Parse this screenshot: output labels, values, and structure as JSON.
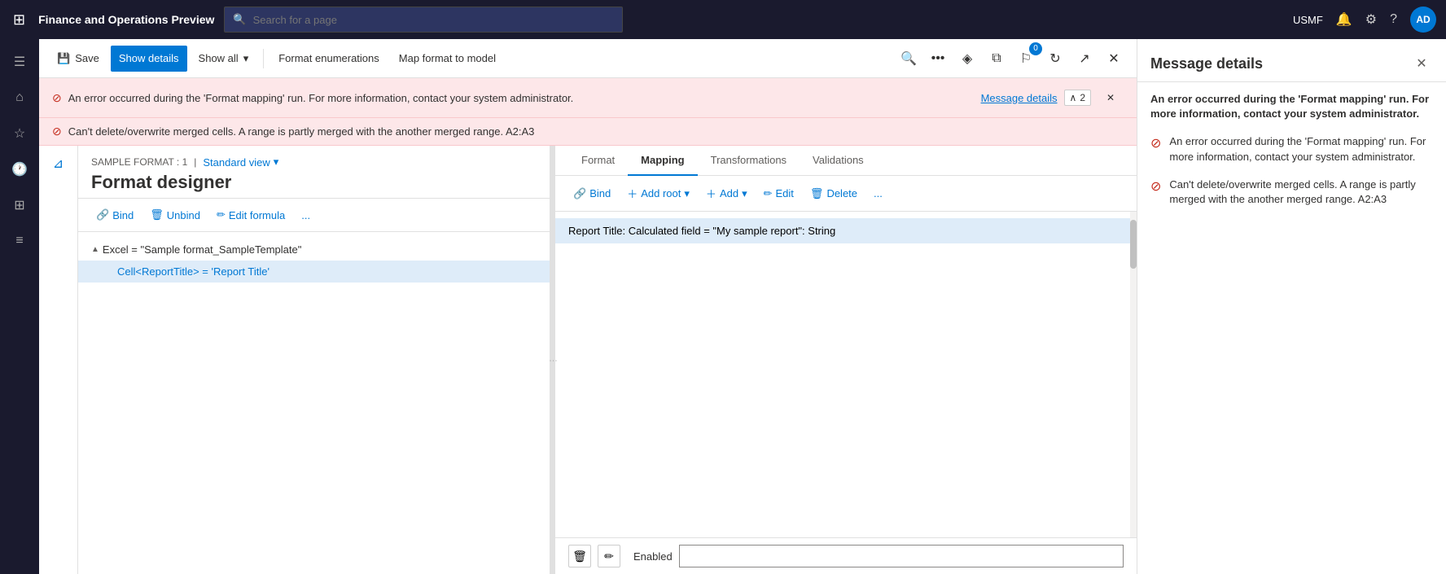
{
  "topnav": {
    "title": "Finance and Operations Preview",
    "search_placeholder": "Search for a page",
    "company": "USMF",
    "avatar": "AD"
  },
  "toolbar": {
    "save_label": "Save",
    "show_details_label": "Show details",
    "show_all_label": "Show all",
    "format_enumerations_label": "Format enumerations",
    "map_format_to_model_label": "Map format to model",
    "badge_count": "0"
  },
  "errors": {
    "error1_text": "An error occurred during the 'Format mapping' run. For more information, contact your system administrator.",
    "error2_text": "Can't delete/overwrite merged cells. A range is partly merged with the another merged range. A2:A3",
    "message_details_link": "Message details",
    "counter": "2"
  },
  "format_designer": {
    "sample_label": "SAMPLE FORMAT : 1",
    "view_label": "Standard view",
    "title": "Format designer",
    "bind_label": "Bind",
    "unbind_label": "Unbind",
    "edit_formula_label": "Edit formula",
    "more_label": "...",
    "tree": {
      "root_item": "Excel = \"Sample format_SampleTemplate\"",
      "child_item": "Cell<ReportTitle> = 'Report Title'"
    }
  },
  "mapping": {
    "tabs": [
      "Format",
      "Mapping",
      "Transformations",
      "Validations"
    ],
    "active_tab": "Mapping",
    "bind_label": "Bind",
    "add_root_label": "Add root",
    "add_label": "Add",
    "edit_label": "Edit",
    "delete_label": "Delete",
    "more_label": "...",
    "selected_item": "Report Title: Calculated field = \"My sample report\": String"
  },
  "bottom_controls": {
    "enabled_label": "Enabled",
    "enabled_value": ""
  },
  "message_panel": {
    "title": "Message details",
    "summary": "An error occurred during the 'Format mapping' run. For more information, contact your system administrator.",
    "items": [
      {
        "text": "An error occurred during the 'Format mapping' run. For more information, contact your system administrator."
      },
      {
        "text": "Can't delete/overwrite merged cells. A range is partly merged with the another merged range. A2:A3"
      }
    ]
  },
  "sidebar": {
    "icons": [
      "menu",
      "home",
      "star",
      "history",
      "grid",
      "list"
    ]
  }
}
